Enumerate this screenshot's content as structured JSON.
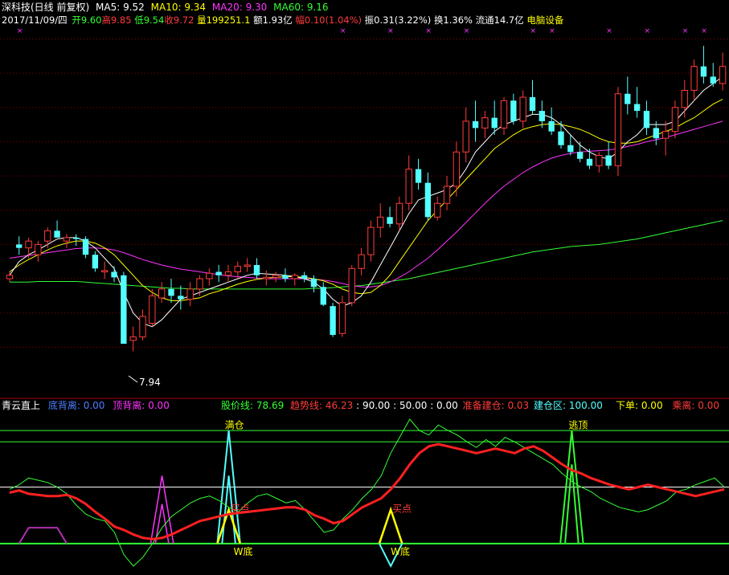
{
  "top_header": {
    "title": "深科技(日线 前复权)",
    "ma5": "MA5: 9.52",
    "ma10": "MA10: 9.34",
    "ma20": "MA20: 9.30",
    "ma60": "MA60: 9.16"
  },
  "quote_line": {
    "date": "2017/11/09/四",
    "open": "开9.60",
    "high": "高9.85",
    "low": "低9.54",
    "close": "收9.72",
    "volume": "量199251.1",
    "amount": "额1.93亿",
    "change": "幅0.10(1.04%)",
    "amplitude": "振0.31(3.22%)",
    "turnover": "换1.36%",
    "float_cap": "流通14.7亿",
    "sector": "电脑设备"
  },
  "low_marker": "7.94",
  "indicator_header": {
    "name": "青云直上",
    "bottom_div": "底背离: 0.00",
    "top_div": "顶背离: 0.00",
    "price_line": "股价线: 78.69",
    "trend_line": "趋势线: 46.23",
    "l90": ": 90.00",
    "l50": ": 50.00",
    "l0": ": 0.00",
    "prep": "准备建仓: 0.03",
    "build": "建仓区: 100.00",
    "order": "下单: 0.00",
    "ride": "乘离: 0.00"
  },
  "annotations": {
    "full_position": "满仓",
    "escape_top": "逃顶",
    "buy_point_1": "买点",
    "buy_point_2": "买点",
    "w_bottom_1": "W底",
    "w_bottom_2": "W底"
  },
  "colors": {
    "up": "#ff3b3b",
    "down": "#54ffff",
    "ma5": "#ffffff",
    "ma10": "#ffff00",
    "ma20": "#ff33ff",
    "ma60": "#33ff33",
    "trend": "#ff2020",
    "price_line": "#33ff33",
    "grid": "#8b0000"
  },
  "chart_data": [
    {
      "type": "candlestick",
      "ylim": [
        7.5,
        12.6
      ],
      "markers_top": [
        1,
        35,
        40,
        44,
        48,
        55,
        57,
        63,
        67,
        71,
        73
      ],
      "candles": [
        [
          9.0,
          9.1,
          8.95,
          9.05
        ],
        [
          9.5,
          9.62,
          9.35,
          9.45
        ],
        [
          9.45,
          9.6,
          9.3,
          9.55
        ],
        [
          9.35,
          9.55,
          9.25,
          9.5
        ],
        [
          9.55,
          9.75,
          9.45,
          9.7
        ],
        [
          9.7,
          9.85,
          9.6,
          9.6
        ],
        [
          9.55,
          9.65,
          9.45,
          9.6
        ],
        [
          9.6,
          9.65,
          9.48,
          9.58
        ],
        [
          9.58,
          9.62,
          9.3,
          9.35
        ],
        [
          9.35,
          9.4,
          9.1,
          9.15
        ],
        [
          9.1,
          9.25,
          9.0,
          9.12
        ],
        [
          9.1,
          9.18,
          8.95,
          9.02
        ],
        [
          9.05,
          9.1,
          8.15,
          8.05
        ],
        [
          8.1,
          8.3,
          7.94,
          8.15
        ],
        [
          8.15,
          8.55,
          8.1,
          8.45
        ],
        [
          8.35,
          8.85,
          8.3,
          8.75
        ],
        [
          8.72,
          8.95,
          8.65,
          8.85
        ],
        [
          8.85,
          9.0,
          8.65,
          8.75
        ],
        [
          8.75,
          8.9,
          8.55,
          8.7
        ],
        [
          8.7,
          8.95,
          8.6,
          8.85
        ],
        [
          8.85,
          9.05,
          8.75,
          9.0
        ],
        [
          9.0,
          9.15,
          8.9,
          9.08
        ],
        [
          9.1,
          9.2,
          8.95,
          9.05
        ],
        [
          9.05,
          9.2,
          8.95,
          9.1
        ],
        [
          9.1,
          9.25,
          9.0,
          9.18
        ],
        [
          9.18,
          9.3,
          9.1,
          9.2
        ],
        [
          9.2,
          9.3,
          9.0,
          9.05
        ],
        [
          9.0,
          9.12,
          8.9,
          9.02
        ],
        [
          9.02,
          9.1,
          8.95,
          9.05
        ],
        [
          9.05,
          9.15,
          8.95,
          9.0
        ],
        [
          9.0,
          9.08,
          8.9,
          9.05
        ],
        [
          9.05,
          9.1,
          8.95,
          9.0
        ],
        [
          9.0,
          9.05,
          8.8,
          8.88
        ],
        [
          8.88,
          8.95,
          8.6,
          8.62
        ],
        [
          8.6,
          8.65,
          8.15,
          8.18
        ],
        [
          8.2,
          8.75,
          8.15,
          8.65
        ],
        [
          8.65,
          9.2,
          8.6,
          9.15
        ],
        [
          9.15,
          9.45,
          9.05,
          9.35
        ],
        [
          9.35,
          9.85,
          9.25,
          9.75
        ],
        [
          9.75,
          10.1,
          9.6,
          9.9
        ],
        [
          9.9,
          10.05,
          9.75,
          9.8
        ],
        [
          9.8,
          10.2,
          9.7,
          10.1
        ],
        [
          10.1,
          10.8,
          10.0,
          10.6
        ],
        [
          10.6,
          10.75,
          10.3,
          10.4
        ],
        [
          10.4,
          10.55,
          9.85,
          9.9
        ],
        [
          9.9,
          10.2,
          9.85,
          10.1
        ],
        [
          10.1,
          10.5,
          10.0,
          10.35
        ],
        [
          10.35,
          11.0,
          10.2,
          10.85
        ],
        [
          10.85,
          11.5,
          10.7,
          11.3
        ],
        [
          11.3,
          11.6,
          11.0,
          11.2
        ],
        [
          11.2,
          11.45,
          11.05,
          11.35
        ],
        [
          11.35,
          11.6,
          11.1,
          11.2
        ],
        [
          11.2,
          11.65,
          11.1,
          11.6
        ],
        [
          11.6,
          11.7,
          11.25,
          11.3
        ],
        [
          11.3,
          11.75,
          11.2,
          11.65
        ],
        [
          11.65,
          11.9,
          11.4,
          11.45
        ],
        [
          11.45,
          11.6,
          11.2,
          11.3
        ],
        [
          11.3,
          11.5,
          11.1,
          11.15
        ],
        [
          11.15,
          11.3,
          10.9,
          10.95
        ],
        [
          10.95,
          11.1,
          10.8,
          10.85
        ],
        [
          10.85,
          11.0,
          10.7,
          10.75
        ],
        [
          10.75,
          10.9,
          10.6,
          10.65
        ],
        [
          10.65,
          10.85,
          10.55,
          10.8
        ],
        [
          10.8,
          11.0,
          10.6,
          10.65
        ],
        [
          10.65,
          11.8,
          10.5,
          11.7
        ],
        [
          11.7,
          11.95,
          11.4,
          11.55
        ],
        [
          11.55,
          11.8,
          11.35,
          11.45
        ],
        [
          11.45,
          11.6,
          11.1,
          11.2
        ],
        [
          11.2,
          11.3,
          10.95,
          11.05
        ],
        [
          11.05,
          11.3,
          10.8,
          11.15
        ],
        [
          11.15,
          11.6,
          11.05,
          11.5
        ],
        [
          11.5,
          11.9,
          11.35,
          11.75
        ],
        [
          11.75,
          12.2,
          11.6,
          12.1
        ],
        [
          12.1,
          12.4,
          11.85,
          11.95
        ],
        [
          11.95,
          12.15,
          11.8,
          11.85
        ],
        [
          11.85,
          12.3,
          11.75,
          12.1
        ]
      ],
      "ma5": [
        9.05,
        9.25,
        9.35,
        9.42,
        9.5,
        9.58,
        9.6,
        9.6,
        9.55,
        9.45,
        9.3,
        9.15,
        8.8,
        8.5,
        8.35,
        8.3,
        8.4,
        8.55,
        8.7,
        8.75,
        8.8,
        8.85,
        8.9,
        8.95,
        9.0,
        9.05,
        9.08,
        9.07,
        9.06,
        9.05,
        9.03,
        9.0,
        8.95,
        8.85,
        8.7,
        8.6,
        8.65,
        8.75,
        8.95,
        9.2,
        9.45,
        9.7,
        9.95,
        10.15,
        10.2,
        10.25,
        10.3,
        10.4,
        10.6,
        10.85,
        11.0,
        11.15,
        11.25,
        11.3,
        11.35,
        11.4,
        11.4,
        11.35,
        11.25,
        11.1,
        10.95,
        10.85,
        10.78,
        10.75,
        10.85,
        11.0,
        11.1,
        11.25,
        11.25,
        11.25,
        11.3,
        11.45,
        11.6,
        11.75,
        11.85,
        11.95
      ],
      "ma10": [
        9.1,
        9.2,
        9.28,
        9.35,
        9.42,
        9.48,
        9.52,
        9.55,
        9.55,
        9.52,
        9.45,
        9.35,
        9.2,
        9.05,
        8.9,
        8.8,
        8.72,
        8.68,
        8.68,
        8.7,
        8.72,
        8.78,
        8.82,
        8.87,
        8.92,
        8.96,
        8.99,
        9.01,
        9.02,
        9.03,
        9.03,
        9.02,
        9.0,
        8.97,
        8.92,
        8.85,
        8.8,
        8.78,
        8.8,
        8.9,
        9.05,
        9.25,
        9.45,
        9.65,
        9.85,
        10.0,
        10.15,
        10.3,
        10.45,
        10.6,
        10.75,
        10.9,
        11.0,
        11.1,
        11.18,
        11.22,
        11.25,
        11.26,
        11.25,
        11.22,
        11.18,
        11.12,
        11.05,
        11.0,
        10.98,
        10.98,
        11.0,
        11.05,
        11.1,
        11.15,
        11.2,
        11.28,
        11.35,
        11.45,
        11.55,
        11.62
      ],
      "ma20": [
        9.3,
        9.32,
        9.34,
        9.36,
        9.38,
        9.4,
        9.42,
        9.44,
        9.45,
        9.45,
        9.44,
        9.42,
        9.38,
        9.33,
        9.28,
        9.24,
        9.2,
        9.17,
        9.14,
        9.12,
        9.1,
        9.08,
        9.06,
        9.04,
        9.03,
        9.02,
        9.01,
        9.0,
        9.0,
        9.0,
        9.0,
        9.0,
        8.99,
        8.98,
        8.96,
        8.93,
        8.9,
        8.88,
        8.88,
        8.9,
        8.95,
        9.02,
        9.1,
        9.2,
        9.3,
        9.42,
        9.55,
        9.68,
        9.82,
        9.96,
        10.1,
        10.23,
        10.35,
        10.45,
        10.55,
        10.63,
        10.7,
        10.76,
        10.8,
        10.83,
        10.85,
        10.86,
        10.87,
        10.88,
        10.9,
        10.93,
        10.96,
        11.0,
        11.03,
        11.06,
        11.1,
        11.14,
        11.18,
        11.22,
        11.26,
        11.3
      ],
      "ma60": [
        8.95,
        8.95,
        8.95,
        8.96,
        8.96,
        8.96,
        8.96,
        8.96,
        8.95,
        8.94,
        8.93,
        8.92,
        8.91,
        8.9,
        8.89,
        8.88,
        8.87,
        8.86,
        8.86,
        8.85,
        8.85,
        8.85,
        8.85,
        8.85,
        8.85,
        8.85,
        8.85,
        8.85,
        8.85,
        8.85,
        8.85,
        8.85,
        8.86,
        8.86,
        8.87,
        8.88,
        8.89,
        8.9,
        8.92,
        8.94,
        8.96,
        8.98,
        9.0,
        9.03,
        9.06,
        9.09,
        9.12,
        9.15,
        9.18,
        9.21,
        9.24,
        9.27,
        9.3,
        9.33,
        9.36,
        9.39,
        9.41,
        9.43,
        9.45,
        9.47,
        9.48,
        9.49,
        9.5,
        9.52,
        9.54,
        9.56,
        9.58,
        9.61,
        9.64,
        9.67,
        9.7,
        9.73,
        9.76,
        9.79,
        9.82,
        9.85
      ]
    },
    {
      "type": "line",
      "ylim": [
        -25,
        115
      ],
      "levels": [
        0,
        50,
        90,
        100
      ],
      "trend": [
        45,
        47,
        44,
        43,
        42,
        42,
        43,
        40,
        35,
        28,
        22,
        15,
        12,
        8,
        5,
        4,
        5,
        8,
        12,
        16,
        20,
        22,
        24,
        26,
        27,
        28,
        29,
        30,
        31,
        32,
        32,
        30,
        25,
        22,
        18,
        20,
        26,
        32,
        36,
        40,
        48,
        58,
        70,
        80,
        86,
        88,
        86,
        84,
        82,
        80,
        82,
        84,
        82,
        80,
        84,
        86,
        82,
        76,
        70,
        65,
        62,
        58,
        55,
        52,
        50,
        48,
        50,
        52,
        50,
        48,
        46,
        44,
        42,
        44,
        46,
        48
      ],
      "price_line": [
        48,
        52,
        58,
        56,
        54,
        50,
        44,
        34,
        26,
        22,
        20,
        10,
        -10,
        -20,
        -12,
        0,
        14,
        24,
        30,
        36,
        40,
        42,
        38,
        32,
        28,
        36,
        42,
        44,
        40,
        36,
        38,
        30,
        20,
        10,
        12,
        22,
        30,
        40,
        48,
        60,
        80,
        95,
        110,
        100,
        96,
        105,
        100,
        96,
        90,
        85,
        92,
        86,
        94,
        90,
        85,
        80,
        75,
        70,
        62,
        55,
        50,
        46,
        40,
        36,
        32,
        30,
        28,
        30,
        34,
        38,
        46,
        48,
        52,
        55,
        58,
        50
      ],
      "peaks_full": [
        23
      ],
      "peaks_escape": [
        59
      ],
      "small_peaks": [
        16
      ],
      "buy_points": [
        23,
        40
      ],
      "w_bottoms": [
        40
      ]
    }
  ]
}
